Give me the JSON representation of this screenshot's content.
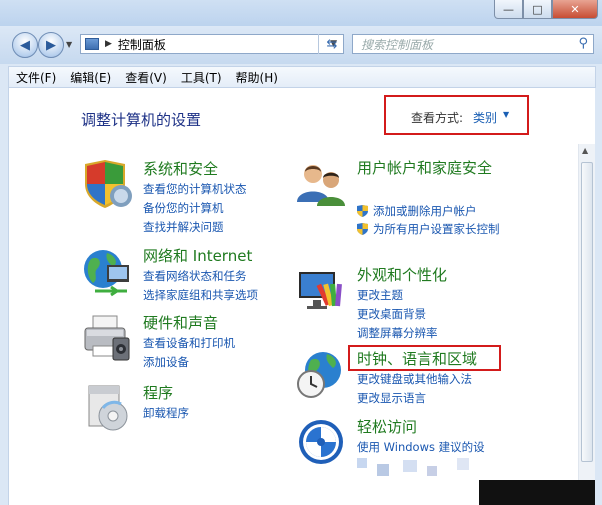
{
  "window": {
    "caption_buttons": {
      "minimize": "—",
      "maximize": "□",
      "close": "✕"
    }
  },
  "navbar": {
    "breadcrumb": "控制面板",
    "search_placeholder": "搜索控制面板"
  },
  "menu": [
    "文件(F)",
    "编辑(E)",
    "查看(V)",
    "工具(T)",
    "帮助(H)"
  ],
  "page": {
    "title": "调整计算机的设置",
    "view_by_label": "查看方式:",
    "view_by_value": "类别"
  },
  "categories": {
    "system": {
      "title": "系统和安全",
      "links": [
        "查看您的计算机状态",
        "备份您的计算机",
        "查找并解决问题"
      ]
    },
    "network": {
      "title": "网络和 Internet",
      "links": [
        "查看网络状态和任务",
        "选择家庭组和共享选项"
      ]
    },
    "hardware": {
      "title": "硬件和声音",
      "links": [
        "查看设备和打印机",
        "添加设备"
      ]
    },
    "programs": {
      "title": "程序",
      "links": [
        "卸载程序"
      ]
    },
    "users": {
      "title": "用户帐户和家庭安全",
      "links": [
        "添加或删除用户帐户",
        "为所有用户设置家长控制"
      ]
    },
    "appearance": {
      "title": "外观和个性化",
      "links": [
        "更改主题",
        "更改桌面背景",
        "调整屏幕分辨率"
      ]
    },
    "clock": {
      "title": "时钟、语言和区域",
      "links": [
        "更改键盘或其他输入法",
        "更改显示语言"
      ]
    },
    "ease": {
      "title": "轻松访问",
      "links": [
        "使用 Windows 建议的设"
      ]
    }
  },
  "colors": {
    "highlight": "#d31b1b",
    "link": "#1a57b0",
    "category_title": "#1f7a1f",
    "heading": "#1e3287"
  },
  "icons": [
    "back-arrow-icon",
    "forward-arrow-icon",
    "control-panel-icon",
    "refresh-icon",
    "search-icon",
    "shield-icon",
    "globe-icon",
    "printer-icon",
    "users-icon",
    "monitor-icon",
    "clock-globe-icon",
    "ease-of-access-icon"
  ]
}
